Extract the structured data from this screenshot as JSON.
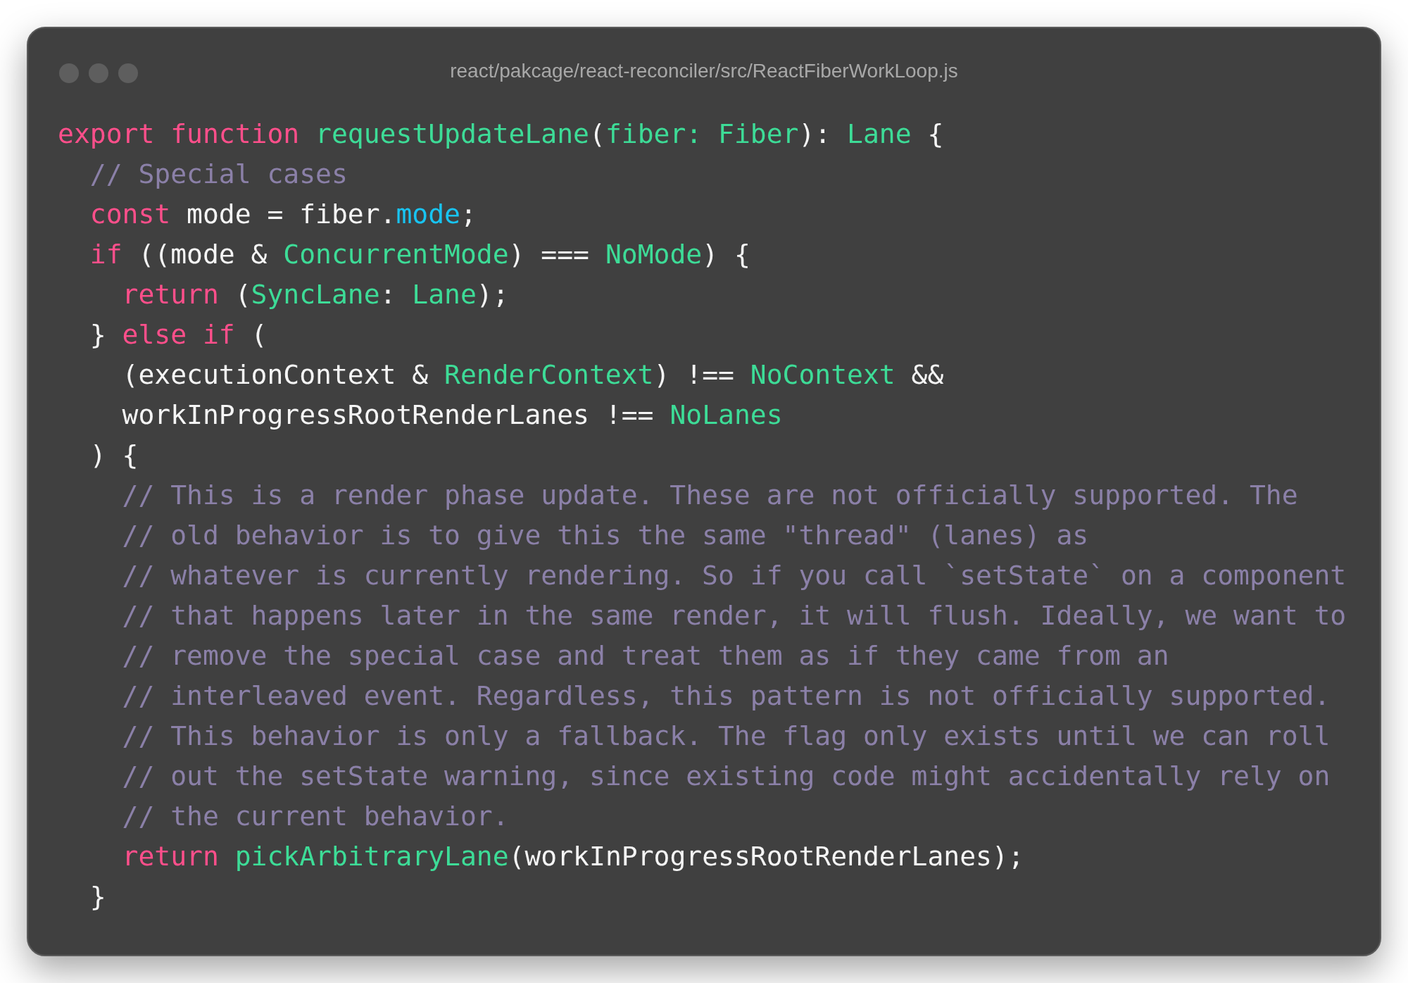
{
  "window": {
    "title": "react/pakcage/react-reconciler/src/ReactFiberWorkLoop.js"
  },
  "code_lines": [
    [
      {
        "kind": "keyword",
        "text": "export function "
      },
      {
        "kind": "name",
        "text": "requestUpdateLane"
      },
      {
        "kind": "plain",
        "text": "("
      },
      {
        "kind": "name",
        "text": "fiber: Fiber"
      },
      {
        "kind": "plain",
        "text": "): "
      },
      {
        "kind": "name",
        "text": "Lane"
      },
      {
        "kind": "plain",
        "text": " {"
      }
    ],
    [
      {
        "kind": "comment",
        "text": "  // Special cases"
      }
    ],
    [
      {
        "kind": "keyword",
        "text": "  const"
      },
      {
        "kind": "plain",
        "text": " mode = fiber."
      },
      {
        "kind": "property",
        "text": "mode"
      },
      {
        "kind": "plain",
        "text": ";"
      }
    ],
    [
      {
        "kind": "keyword",
        "text": "  if"
      },
      {
        "kind": "plain",
        "text": " ((mode & "
      },
      {
        "kind": "name",
        "text": "ConcurrentMode"
      },
      {
        "kind": "plain",
        "text": ") === "
      },
      {
        "kind": "name",
        "text": "NoMode"
      },
      {
        "kind": "plain",
        "text": ") {"
      }
    ],
    [
      {
        "kind": "keyword",
        "text": "    return"
      },
      {
        "kind": "plain",
        "text": " ("
      },
      {
        "kind": "name",
        "text": "SyncLane"
      },
      {
        "kind": "plain",
        "text": ": "
      },
      {
        "kind": "name",
        "text": "Lane"
      },
      {
        "kind": "plain",
        "text": ");"
      }
    ],
    [
      {
        "kind": "plain",
        "text": "  } "
      },
      {
        "kind": "keyword",
        "text": "else if"
      },
      {
        "kind": "plain",
        "text": " ("
      }
    ],
    [
      {
        "kind": "plain",
        "text": "    (executionContext & "
      },
      {
        "kind": "name",
        "text": "RenderContext"
      },
      {
        "kind": "plain",
        "text": ") !== "
      },
      {
        "kind": "name",
        "text": "NoContext"
      },
      {
        "kind": "plain",
        "text": " &&"
      }
    ],
    [
      {
        "kind": "plain",
        "text": "    workInProgressRootRenderLanes !== "
      },
      {
        "kind": "name",
        "text": "NoLanes"
      }
    ],
    [
      {
        "kind": "plain",
        "text": "  ) {"
      }
    ],
    [
      {
        "kind": "comment",
        "text": "    // This is a render phase update. These are not officially supported. The"
      }
    ],
    [
      {
        "kind": "comment",
        "text": "    // old behavior is to give this the same \"thread\" (lanes) as"
      }
    ],
    [
      {
        "kind": "comment",
        "text": "    // whatever is currently rendering. So if you call `setState` on a component"
      }
    ],
    [
      {
        "kind": "comment",
        "text": "    // that happens later in the same render, it will flush. Ideally, we want to"
      }
    ],
    [
      {
        "kind": "comment",
        "text": "    // remove the special case and treat them as if they came from an"
      }
    ],
    [
      {
        "kind": "comment",
        "text": "    // interleaved event. Regardless, this pattern is not officially supported."
      }
    ],
    [
      {
        "kind": "comment",
        "text": "    // This behavior is only a fallback. The flag only exists until we can roll"
      }
    ],
    [
      {
        "kind": "comment",
        "text": "    // out the setState warning, since existing code might accidentally rely on"
      }
    ],
    [
      {
        "kind": "comment",
        "text": "    // the current behavior."
      }
    ],
    [
      {
        "kind": "keyword",
        "text": "    return "
      },
      {
        "kind": "name",
        "text": "pickArbitraryLane"
      },
      {
        "kind": "plain",
        "text": "(workInProgressRootRenderLanes);"
      }
    ],
    [
      {
        "kind": "plain",
        "text": "  }"
      }
    ]
  ]
}
